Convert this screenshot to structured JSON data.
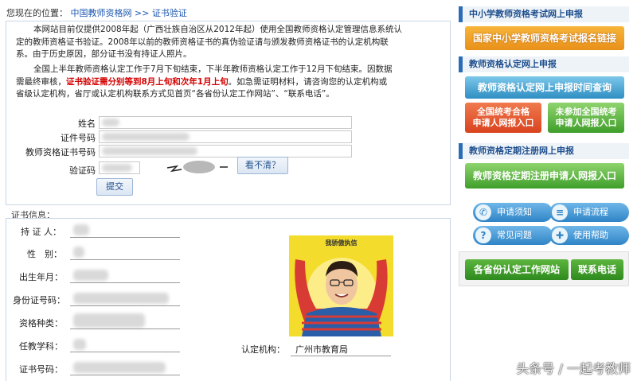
{
  "breadcrumb": {
    "prefix": "您现在的位置：",
    "home": "中国教师资格网",
    "sep": ">>",
    "current": "证书验证"
  },
  "notice": {
    "para1_lines": [
      "本网站目前仅提供2008年起（广西壮族自治区从2012年起）使用全国教师资格认定管理信息系统认",
      "定的教师资格证书验证。2008年以前的教师资格证书的真伪验证请与颁发教师资格证书的认定机构联",
      "系。由于历史原因，部分证书没有持证人照片。"
    ],
    "para2_line1": "全国上半年教师资格认定工作于7月下旬结束，下半年教师资格认定工作于12月下旬结束。因数据",
    "para2_line2_pre": "需最终审核，",
    "para2_line2_red": "证书验证需分别等到8月上旬和次年1月上旬",
    "para2_line2_post": "。如急需证明材料，请咨询您的认定机构或",
    "para2_line3": "省级认定机构，省厅或认定机构联系方式见首页“各省份认定工作网站”、“联系电话”。"
  },
  "form": {
    "name_label": "姓名",
    "cert_id_label": "证件号码",
    "qual_cert_label": "教师资格证书号码",
    "captcha_label": "验证码",
    "unclear_label": "看不清？",
    "submit_label": "提交"
  },
  "cert": {
    "title": "证书信息：",
    "holder_label": "持 证 人：",
    "gender_label": "性　别：",
    "birth_label": "出生年月：",
    "id_label": "身份证号码：",
    "qual_type_label": "资格种类：",
    "subject_label": "任教学科：",
    "cert_no_label": "证书号码：",
    "agency_label": "认定机构：",
    "agency_value": "广州市教育局",
    "photo_caption": "我骄傲执信"
  },
  "sidebar": {
    "sec1_title": "中小学教师资格考试网上申报",
    "sec1_btn": "国家中小学教师资格考试报名链接",
    "sec2_title": "教师资格认定网上申报",
    "sec2_btn": "教师资格认定网上申报时间查询",
    "btn_passed_l1": "全国统考合格",
    "btn_passed_l2": "申请人网报入口",
    "btn_notjoined_l1": "未参加全国统考",
    "btn_notjoined_l2": "申请人网报入口",
    "sec3_title": "教师资格定期注册网上申报",
    "sec3_btn": "教师资格定期注册申请人网报入口",
    "icon_btn1": "申请须知",
    "icon_btn2": "申请流程",
    "icon_btn3": "常见问题",
    "icon_btn4": "使用帮助",
    "provinces_btn": "各省份认定工作网站",
    "contact_btn": "联系电话"
  },
  "watermark": "头条号 / 一起考教师",
  "colors": {
    "link_blue": "#1a56b0",
    "green": "#3f9e2a",
    "red_btn": "#d9431e",
    "teal": "#2f8fc3",
    "photo_bg": "#f4dc2c"
  }
}
